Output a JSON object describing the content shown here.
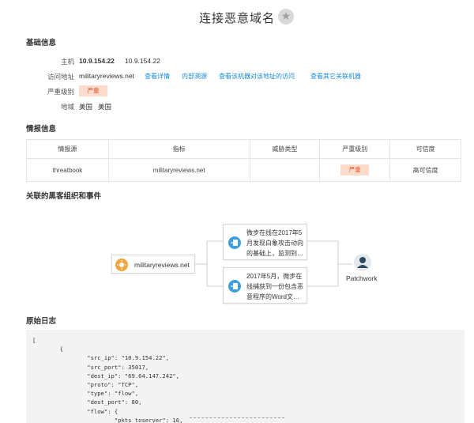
{
  "page": {
    "title": "连接恶意域名"
  },
  "basic": {
    "heading": "基础信息",
    "host": {
      "label": "主机",
      "value_bold": "10.9.154.22",
      "value": "10.9.154.22"
    },
    "visit": {
      "label": "访问地址",
      "value": "militaryreviews.net",
      "links": [
        "查看详情",
        "内部溯源",
        "查看该机器对该地址的访问",
        "查看其它关联机器"
      ]
    },
    "severity": {
      "label": "严重级别",
      "value": "严重"
    },
    "region": {
      "label": "地域",
      "value1": "美国",
      "value2": "美国"
    }
  },
  "intel": {
    "heading": "情报信息",
    "columns": [
      "情报源",
      "指标",
      "威胁类型",
      "严重级别",
      "可信度"
    ],
    "row": {
      "source": "threatbook",
      "indicator": "militaryreviews.net",
      "threat_type": "",
      "severity": "严重",
      "credibility": "高可信度"
    }
  },
  "related": {
    "heading": "关联的黑客组织和事件",
    "domain": "militaryreviews.net",
    "card1": [
      "微步在线在2017年5",
      "月发现白象攻击动向",
      "的基础上，监测到…"
    ],
    "card2": [
      "2017年5月，微步在",
      "线捕获到一份包含恶",
      "意程序的Word文…"
    ],
    "group": "Patchwork"
  },
  "log": {
    "heading": "原始日志",
    "lines": [
      "[",
      "        {",
      "                \"src_ip\": \"10.9.154.22\",",
      "                \"src_port\": 35017,",
      "                \"dest_ip\": \"69.64.147.242\",",
      "                \"proto\": \"TCP\",",
      "                \"type\": \"flow\",",
      "                \"dest_port\": 80,",
      "                \"flow\": {",
      "                        \"pkts_toserver\": 16,"
    ]
  },
  "colors": {
    "accent": "#1a8bd6",
    "severity_bg": "#fddccd",
    "severity_fg": "#e8541e",
    "node_orange": "#f2a33a",
    "node_blue": "#3d9fe0",
    "group_dark": "#2f4a5e"
  }
}
